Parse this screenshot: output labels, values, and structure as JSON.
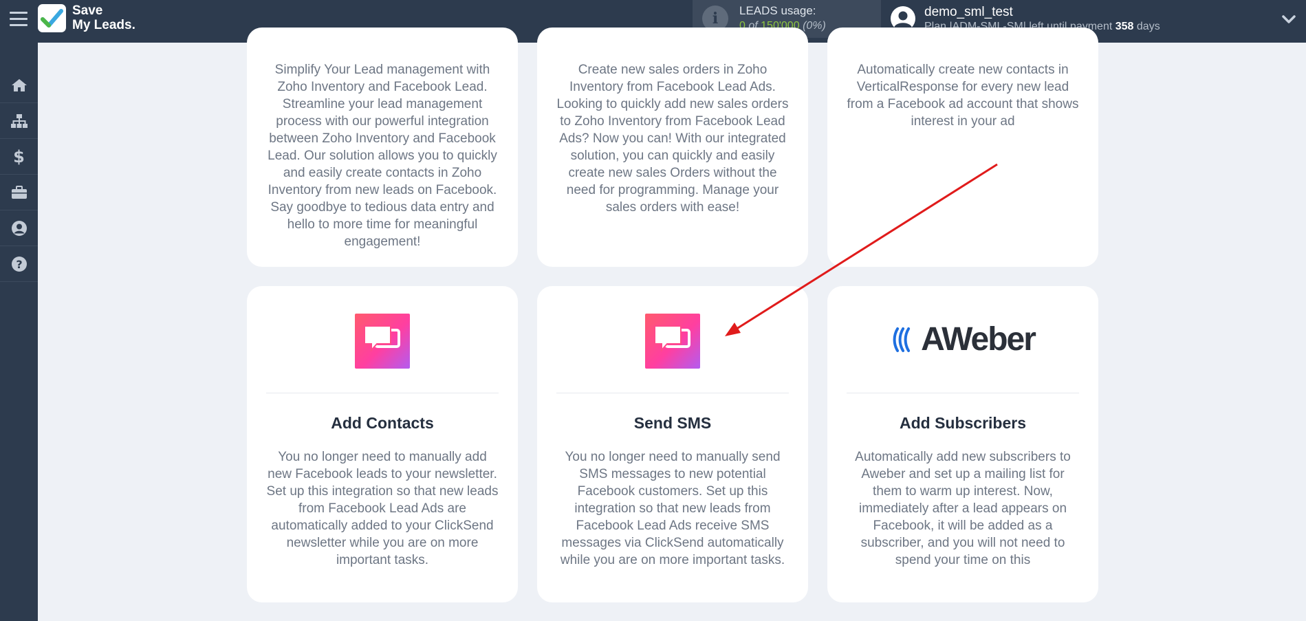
{
  "header": {
    "logo_line1": "Save",
    "logo_line2": "My Leads.",
    "leads_usage_label": "LEADS usage:",
    "leads_used": "0",
    "leads_of": "of",
    "leads_total": "150'000",
    "leads_percent": "(0%)",
    "user_name": "demo_sml_test",
    "plan_prefix": "Plan |ADM-SML-SM| left until payment",
    "plan_days": "358",
    "plan_suffix": "days"
  },
  "sidebar": {
    "items": [
      {
        "icon": "home-icon"
      },
      {
        "icon": "sitemap-icon"
      },
      {
        "icon": "dollar-icon"
      },
      {
        "icon": "briefcase-icon"
      },
      {
        "icon": "user-circle-icon"
      },
      {
        "icon": "question-circle-icon"
      }
    ]
  },
  "cards_top": [
    {
      "description": "Simplify Your Lead management with Zoho Inventory and Facebook Lead. Streamline your lead management process with our powerful integration between Zoho Inventory and Facebook Lead. Our solution allows you to quickly and easily create contacts in Zoho Inventory from new leads on Facebook. Say goodbye to tedious data entry and hello to more time for meaningful engagement!"
    },
    {
      "description": "Create new sales orders in Zoho Inventory from Facebook Lead Ads. Looking to quickly add new sales orders to Zoho Inventory from Facebook Lead Ads? Now you can! With our integrated solution, you can quickly and easily create new sales Orders without the need for programming. Manage your sales orders with ease!"
    },
    {
      "description": "Automatically create new contacts in VerticalResponse for every new lead from a Facebook ad account that shows interest in your ad"
    }
  ],
  "cards_bottom": [
    {
      "title": "Add Contacts",
      "service": "ClickSend",
      "description": "You no longer need to manually add new Facebook leads to your newsletter. Set up this integration so that new leads from Facebook Lead Ads are automatically added to your ClickSend newsletter while you are on more important tasks."
    },
    {
      "title": "Send SMS",
      "service": "ClickSend",
      "description": "You no longer need to manually send SMS messages to new potential Facebook customers. Set up this integration so that new leads from Facebook Lead Ads receive SMS messages via ClickSend automatically while you are on more important tasks."
    },
    {
      "title": "Add Subscribers",
      "service": "AWeber",
      "logo_text": "AWeber",
      "description": "Automatically add new subscribers to Aweber and set up a mailing list for them to warm up interest. Now, immediately after a lead appears on Facebook, it will be added as a subscriber, and you will not need to spend your time on this"
    }
  ],
  "colors": {
    "topbar": "#2d3b4e",
    "accent_green": "#8fc63f",
    "arrow": "#e01b1b"
  }
}
